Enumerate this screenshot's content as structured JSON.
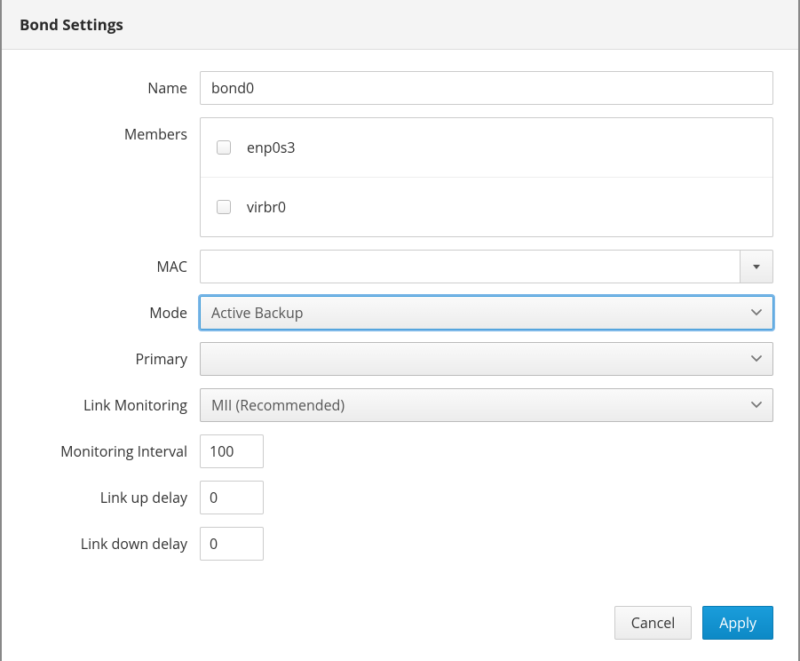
{
  "modal": {
    "title": "Bond Settings"
  },
  "form": {
    "labels": {
      "name": "Name",
      "members": "Members",
      "mac": "MAC",
      "mode": "Mode",
      "primary": "Primary",
      "link_monitoring": "Link Monitoring",
      "monitoring_interval": "Monitoring Interval",
      "link_up_delay": "Link up delay",
      "link_down_delay": "Link down delay"
    },
    "name": {
      "value": "bond0"
    },
    "members": [
      {
        "label": "enp0s3",
        "checked": false
      },
      {
        "label": "virbr0",
        "checked": false
      }
    ],
    "mac": {
      "value": ""
    },
    "mode": {
      "value": "Active Backup"
    },
    "primary": {
      "value": ""
    },
    "link_monitoring": {
      "value": "MII (Recommended)"
    },
    "monitoring_interval": {
      "value": "100"
    },
    "link_up_delay": {
      "value": "0"
    },
    "link_down_delay": {
      "value": "0"
    }
  },
  "buttons": {
    "cancel": "Cancel",
    "apply": "Apply"
  }
}
